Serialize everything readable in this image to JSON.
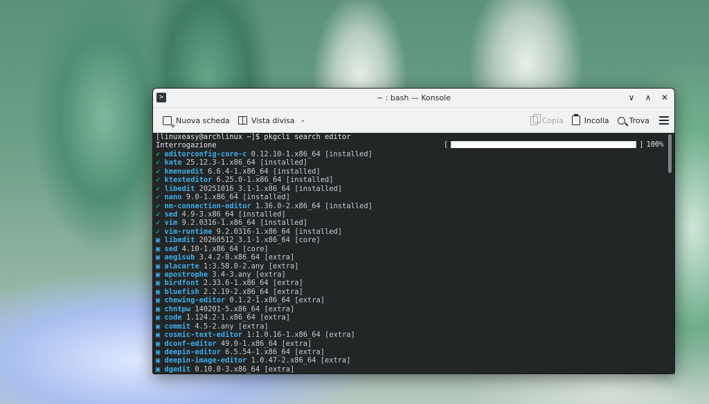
{
  "window": {
    "title": "~ : bash — Konsole",
    "controls": [
      "∨",
      "∧",
      "✕"
    ]
  },
  "toolbar": {
    "new_tab": "Nuova scheda",
    "split_view": "Vista divisa",
    "copy": "Copia",
    "paste": "Incolla",
    "find": "Trova"
  },
  "terminal": {
    "prompt": "[linuxeasy@archlinux ~]$ pkgcli search editor",
    "status": "Interrogazione",
    "progress_percent": 100,
    "progress_label": "100%",
    "results": [
      {
        "mark": "✓",
        "name": "editorconfig-core-c",
        "version": "0.12.10-1.x86_64",
        "repo": "[installed]"
      },
      {
        "mark": "✓",
        "name": "kate",
        "version": "25.12.3-1.x86_64",
        "repo": "[installed]"
      },
      {
        "mark": "✓",
        "name": "kmenuedit",
        "version": "6.6.4-1.x86_64",
        "repo": "[installed]"
      },
      {
        "mark": "✓",
        "name": "ktexteditor",
        "version": "6.25.0-1.x86_64",
        "repo": "[installed]"
      },
      {
        "mark": "✓",
        "name": "libedit",
        "version": "20251016_3.1-1.x86_64",
        "repo": "[installed]"
      },
      {
        "mark": "✓",
        "name": "nano",
        "version": "9.0-1.x86_64",
        "repo": "[installed]"
      },
      {
        "mark": "✓",
        "name": "nm-connection-editor",
        "version": "1.36.0-2.x86_64",
        "repo": "[installed]"
      },
      {
        "mark": "✓",
        "name": "sed",
        "version": "4.9-3.x86_64",
        "repo": "[installed]"
      },
      {
        "mark": "✓",
        "name": "vim",
        "version": "9.2.0316-1.x86_64",
        "repo": "[installed]"
      },
      {
        "mark": "✓",
        "name": "vim-runtime",
        "version": "9.2.0316-1.x86_64",
        "repo": "[installed]"
      },
      {
        "mark": "▣",
        "name": "libedit",
        "version": "20260512_3.1-1.x86_64",
        "repo": "[core]"
      },
      {
        "mark": "▣",
        "name": "sed",
        "version": "4.10-1.x86_64",
        "repo": "[core]"
      },
      {
        "mark": "▣",
        "name": "aegisub",
        "version": "3.4.2-8.x86_64",
        "repo": "[extra]"
      },
      {
        "mark": "▣",
        "name": "alacarte",
        "version": "1:3.58.0-2.any",
        "repo": "[extra]"
      },
      {
        "mark": "▣",
        "name": "apostrophe",
        "version": "3.4-3.any",
        "repo": "[extra]"
      },
      {
        "mark": "▣",
        "name": "birdfont",
        "version": "2.33.6-1.x86_64",
        "repo": "[extra]"
      },
      {
        "mark": "▣",
        "name": "bluefish",
        "version": "2.2.19-2.x86_64",
        "repo": "[extra]"
      },
      {
        "mark": "▣",
        "name": "chewing-editor",
        "version": "0.1.2-1.x86_64",
        "repo": "[extra]"
      },
      {
        "mark": "▣",
        "name": "chntpw",
        "version": "140201-5.x86_64",
        "repo": "[extra]"
      },
      {
        "mark": "▣",
        "name": "code",
        "version": "1.124.2-1.x86_64",
        "repo": "[extra]"
      },
      {
        "mark": "▣",
        "name": "commit",
        "version": "4.5-2.any",
        "repo": "[extra]"
      },
      {
        "mark": "▣",
        "name": "cosmic-text-editor",
        "version": "1:1.0.16-1.x86_64",
        "repo": "[extra]"
      },
      {
        "mark": "▣",
        "name": "dconf-editor",
        "version": "49.0-1.x86_64",
        "repo": "[extra]"
      },
      {
        "mark": "▣",
        "name": "deepin-editor",
        "version": "6.5.54-1.x86_64",
        "repo": "[extra]"
      },
      {
        "mark": "▣",
        "name": "deepin-image-editor",
        "version": "1.0.47-2.x86_64",
        "repo": "[extra]"
      },
      {
        "mark": "▣",
        "name": "dgedit",
        "version": "0.10.0-3.x86_64",
        "repo": "[extra]"
      }
    ]
  }
}
